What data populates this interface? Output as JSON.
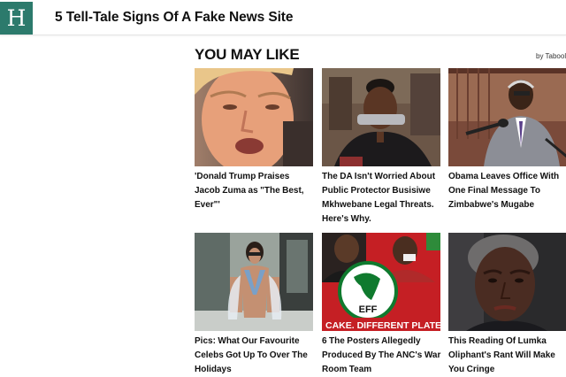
{
  "header": {
    "logo_letter": "H",
    "article_title": "5 Tell-Tale Signs Of A Fake News Site",
    "brand_color": "#2c7a6c"
  },
  "widget": {
    "title": "YOU MAY LIKE",
    "attribution": "by Taboola"
  },
  "cards": [
    {
      "caption": "'Donald Trump Praises Jacob Zuma as \"The Best, Ever\"'",
      "image": "man-speaking-photo"
    },
    {
      "caption": "The DA Isn't Worried About Public Protector Busisiwe Mkhwebane Legal Threats. Here's Why.",
      "image": "woman-portrait-photo"
    },
    {
      "caption": "Obama Leaves Office With One Final Message To Zimbabwe's Mugabe",
      "image": "man-at-podium-photo"
    },
    {
      "caption": "Pics: What Our Favourite Celebs Got Up To Over The Holidays",
      "image": "woman-swimsuit-photo"
    },
    {
      "caption": "6 The Posters Allegedly Produced By The ANC's War Room Team",
      "image": "eff-poster-photo"
    },
    {
      "caption": "This Reading Of Lumka Oliphant's Rant Will Make You Cringe",
      "image": "woman-closeup-photo"
    }
  ],
  "poster": {
    "logo_text": "EFF",
    "banner_text": "CAKE. DIFFERENT PLATE"
  }
}
